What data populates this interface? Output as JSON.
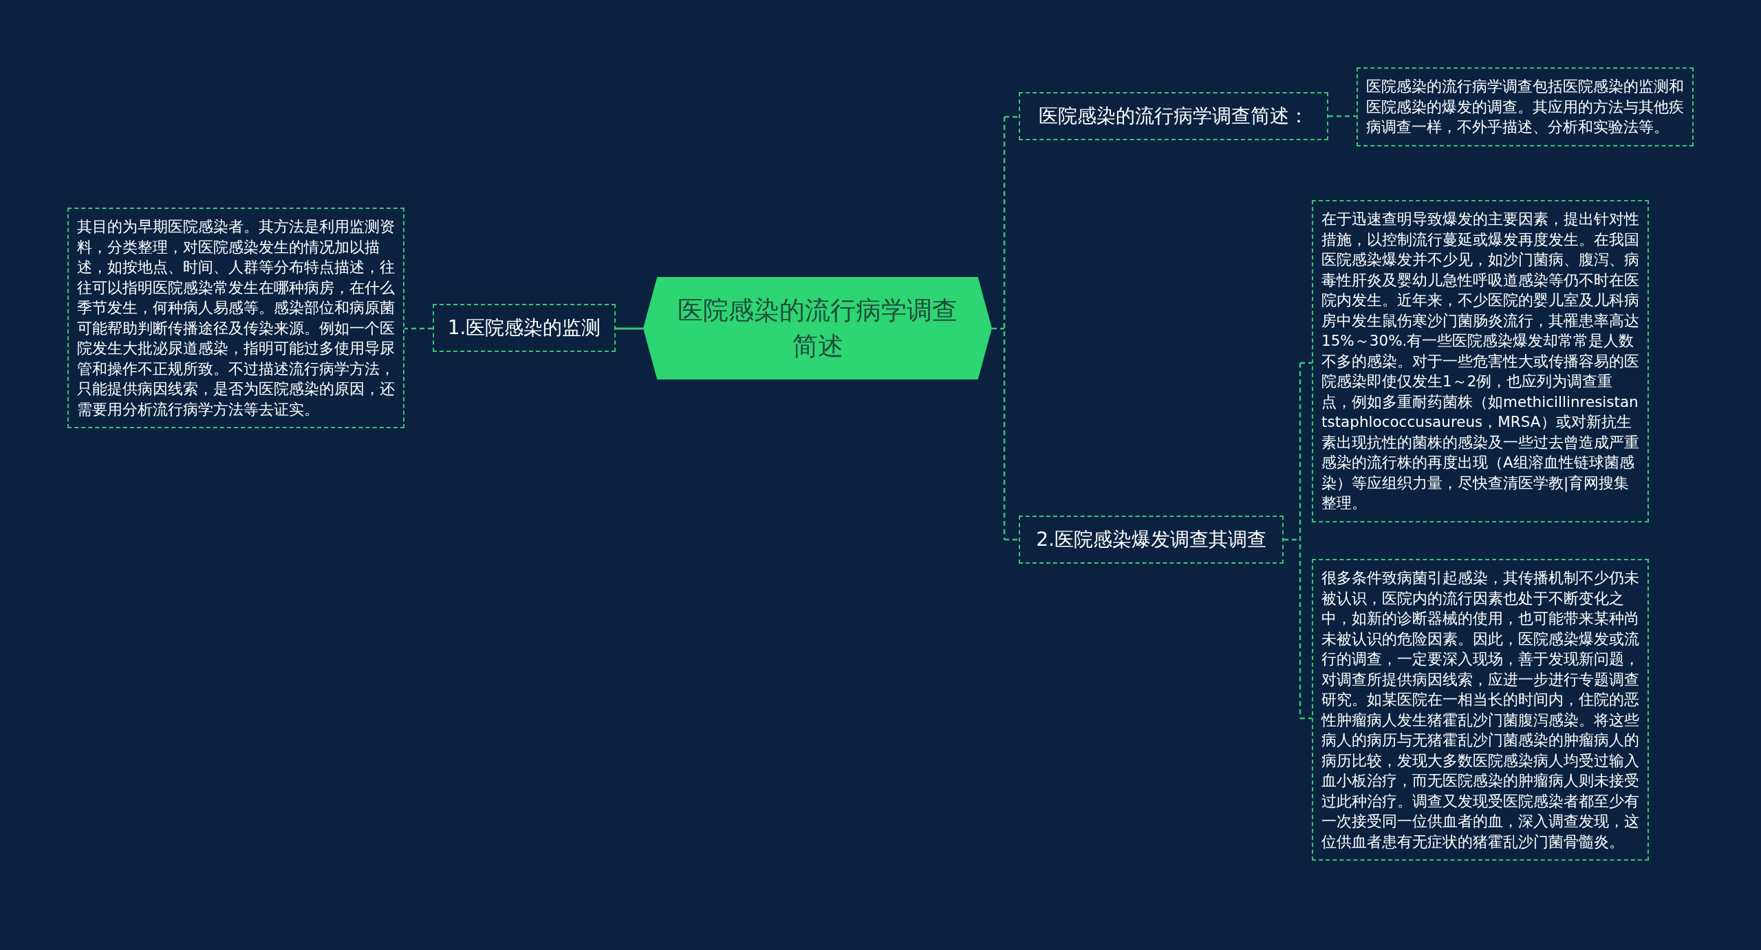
{
  "root": {
    "label": "医院感染的流行病学调查简述"
  },
  "left": [
    {
      "label": "1.医院感染的监测",
      "notes": [
        "其目的为早期医院感染者。其方法是利用监测资料，分类整理，对医院感染发生的情况加以描述，如按地点、时间、人群等分布特点描述，往往可以指明医院感染常发生在哪种病房，在什么季节发生，何种病人易感等。感染部位和病原菌可能帮助判断传播途径及传染来源。例如一个医院发生大批泌尿道感染，指明可能过多使用导尿管和操作不正规所致。不过描述流行病学方法，只能提供病因线索，是否为医院感染的原因，还需要用分析流行病学方法等去证实。"
      ]
    }
  ],
  "right": [
    {
      "label": "医院感染的流行病学调查简述：",
      "notes": [
        "医院感染的流行病学调查包括医院感染的监测和医院感染的爆发的调查。其应用的方法与其他疾病调查一样，不外乎描述、分析和实验法等。"
      ]
    },
    {
      "label": "2.医院感染爆发调查其调查",
      "notes": [
        "在于迅速查明导致爆发的主要因素，提出针对性措施，以控制流行蔓延或爆发再度发生。在我国医院感染爆发并不少见，如沙门菌病、腹泻、病毒性肝炎及婴幼儿急性呼吸道感染等仍不时在医院内发生。近年来，不少医院的婴儿室及儿科病房中发生鼠伤寒沙门菌肠炎流行，其罹患率高达15%～30%.有一些医院感染爆发却常常是人数不多的感染。对于一些危害性大或传播容易的医院感染即使仅发生1～2例，也应列为调查重点，例如多重耐药菌株（如methicillinresistantstaphlococcusaureus，MRSA）或对新抗生素出现抗性的菌株的感染及一些过去曾造成严重感染的流行株的再度出现（A组溶血性链球菌感染）等应组织力量，尽快查清医学教|育网搜集整理。",
        "很多条件致病菌引起感染，其传播机制不少仍未被认识，医院内的流行因素也处于不断变化之中，如新的诊断器械的使用，也可能带来某种尚未被认识的危险因素。因此，医院感染爆发或流行的调查，一定要深入现场，善于发现新问题，对调查所提供病因线索，应进一步进行专题调查研究。如某医院在一相当长的时间内，住院的恶性肿瘤病人发生猪霍乱沙门菌腹泻感染。将这些病人的病历与无猪霍乱沙门菌感染的肿瘤病人的病历比较，发现大多数医院感染病人均受过输入血小板治疗，而无医院感染的肿瘤病人则未接受过此种治疗。调查又发现受医院感染者都至少有一次接受同一位供血者的血，深入调查发现，这位供血者患有无症状的猪霍乱沙门菌骨髓炎。"
      ]
    }
  ]
}
